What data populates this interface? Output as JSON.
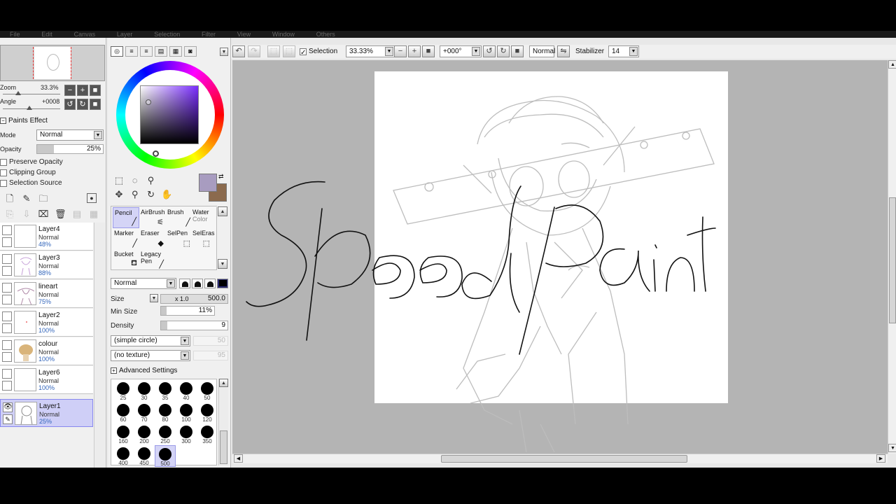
{
  "menu": [
    "File",
    "Edit",
    "Canvas",
    "Layer",
    "Selection",
    "Filter",
    "View",
    "Window",
    "Others"
  ],
  "navigator": {
    "zoom_label": "Zoom",
    "zoom_value": "33.3%",
    "angle_label": "Angle",
    "angle_value": "+0008"
  },
  "paints_effect": {
    "title": "Paints Effect",
    "mode_label": "Mode",
    "mode_value": "Normal",
    "opacity_label": "Opacity",
    "opacity_value": "25%",
    "opacity_fraction": 0.25,
    "preserve_opacity": "Preserve Opacity",
    "clipping_group": "Clipping Group",
    "selection_source": "Selection Source"
  },
  "layers": [
    {
      "name": "Layer4",
      "mode": "Normal",
      "opacity": "48%"
    },
    {
      "name": "Layer3",
      "mode": "Normal",
      "opacity": "88%"
    },
    {
      "name": "lineart",
      "mode": "Normal",
      "opacity": "75%"
    },
    {
      "name": "Layer2",
      "mode": "Normal",
      "opacity": "100%"
    },
    {
      "name": "colour",
      "mode": "Normal",
      "opacity": "100%"
    },
    {
      "name": "Layer6",
      "mode": "Normal",
      "opacity": "100%"
    },
    {
      "name": "Layer1",
      "mode": "Normal",
      "opacity": "25%",
      "selected": true
    }
  ],
  "colors": {
    "primary": "#a89cc0",
    "secondary": "#8b6a4e",
    "accent_selection": "#cfcff7"
  },
  "brushes": [
    {
      "line1": "Pencil",
      "line2": "",
      "selected": true,
      "icon": "pencil-icon"
    },
    {
      "line1": "AirBrush",
      "line2": "",
      "icon": "airbrush-icon"
    },
    {
      "line1": "Brush",
      "line2": "",
      "icon": "brush-icon"
    },
    {
      "line1": "Water",
      "line2": "Color",
      "icon": "water-brush-icon"
    },
    {
      "line1": "Marker",
      "line2": "",
      "icon": "marker-icon"
    },
    {
      "line1": "Eraser",
      "line2": "",
      "icon": "eraser-icon"
    },
    {
      "line1": "SelPen",
      "line2": "",
      "icon": "selpen-icon"
    },
    {
      "line1": "SelEras",
      "line2": "",
      "icon": "seleraser-icon"
    },
    {
      "line1": "Bucket",
      "line2": "",
      "icon": "bucket-icon"
    },
    {
      "line1": "Legacy",
      "line2": "Pen",
      "icon": "legacy-pen-icon"
    }
  ],
  "brush_settings": {
    "blend_mode": "Normal",
    "size_label": "Size",
    "size_multiplier": "x 1.0",
    "size_value": "500.0",
    "min_size_label": "Min Size",
    "min_size_value": "11%",
    "min_size_fraction": 0.11,
    "density_label": "Density",
    "density_value": "9",
    "density_fraction": 0.09,
    "shape": "(simple circle)",
    "shape_value": "50",
    "texture": "(no texture)",
    "texture_value": "95",
    "advanced_label": "Advanced Settings"
  },
  "brush_sizes": [
    "25",
    "30",
    "35",
    "40",
    "50",
    "60",
    "70",
    "80",
    "100",
    "120",
    "160",
    "200",
    "250",
    "300",
    "350",
    "400",
    "450",
    "500"
  ],
  "brush_size_selected": "500",
  "toolbar": {
    "selection_label": "Selection",
    "zoom": "33.33%",
    "rotation": "+000°",
    "blend": "Normal",
    "stabilizer_label": "Stabilizer",
    "stabilizer_value": "14"
  },
  "canvas": {
    "overlay_text": "SpeedPaint"
  }
}
